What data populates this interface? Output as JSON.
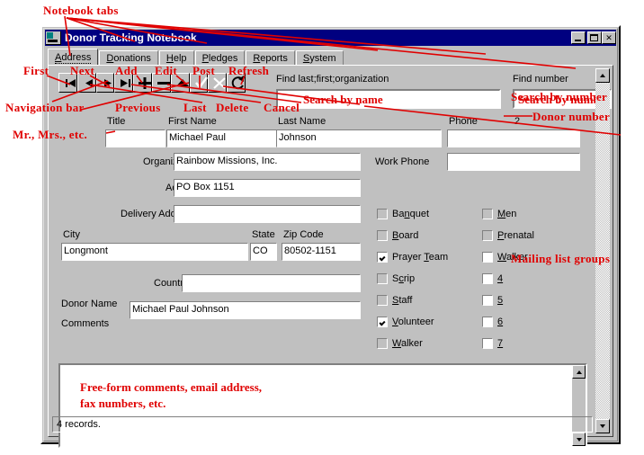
{
  "window": {
    "title": "Donor Tracking Notebook",
    "minimize_label": "Minimize",
    "maximize_label": "Maximize",
    "close_label": "✕"
  },
  "tabs": [
    {
      "label": "Address",
      "active": true
    },
    {
      "label": "Donations",
      "active": false
    },
    {
      "label": "Help",
      "active": false
    },
    {
      "label": "Pledges",
      "active": false
    },
    {
      "label": "Reports",
      "active": false
    },
    {
      "label": "System",
      "active": false
    }
  ],
  "navbar": {
    "buttons": [
      {
        "name": "first",
        "glyph": "first"
      },
      {
        "name": "previous",
        "glyph": "prev"
      },
      {
        "name": "next",
        "glyph": "next"
      },
      {
        "name": "last",
        "glyph": "last"
      },
      {
        "name": "add",
        "glyph": "plus"
      },
      {
        "name": "delete",
        "glyph": "minus"
      },
      {
        "name": "edit",
        "glyph": "triangle"
      },
      {
        "name": "post",
        "glyph": "check"
      },
      {
        "name": "cancel",
        "glyph": "xmark"
      },
      {
        "name": "refresh",
        "glyph": "refresh"
      }
    ]
  },
  "find": {
    "name_label": "Find last;first;organization",
    "name_value": "Search by name",
    "number_label": "Find number",
    "number_value": "Search by number"
  },
  "form": {
    "title_label": "Title",
    "title_value": "",
    "first_name_label": "First Name",
    "first_name_value": "Michael Paul",
    "last_name_label": "Last Name",
    "last_name_value": "Johnson",
    "phone_label": "Phone",
    "phone_value": "",
    "donor_number": "2",
    "organization_label": "Organization",
    "organization_value": "Rainbow Missions, Inc.",
    "work_phone_label": "Work Phone",
    "work_phone_value": "",
    "address_label": "Address",
    "address_value": "PO Box 1151",
    "delivery_address_label": "Delivery Address",
    "delivery_address_value": "",
    "city_label": "City",
    "city_value": "Longmont",
    "state_label": "State",
    "state_value": "CO",
    "zip_label": "Zip Code",
    "zip_value": "80502-1151",
    "country_label": "Country",
    "country_value": "",
    "donor_name_label": "Donor Name",
    "donor_name_value": "Michael Paul Johnson",
    "comments_label": "Comments",
    "comments_value": ""
  },
  "groups": {
    "left": [
      {
        "label": "Banquet",
        "accel": "q",
        "checked": false,
        "dim": true
      },
      {
        "label": "Board",
        "accel": "B",
        "checked": false,
        "dim": true
      },
      {
        "label": "Prayer Team",
        "accel": "T",
        "checked": true,
        "dim": false
      },
      {
        "label": "Scrip",
        "accel": "c",
        "checked": false,
        "dim": true
      },
      {
        "label": "Staff",
        "accel": "S",
        "checked": false,
        "dim": true
      },
      {
        "label": "Volunteer",
        "accel": "V",
        "checked": true,
        "dim": false
      },
      {
        "label": "Walker",
        "accel": "W",
        "checked": false,
        "dim": true
      }
    ],
    "right": [
      {
        "label": "Men",
        "accel": "M",
        "checked": false,
        "dim": true
      },
      {
        "label": "Prenatal",
        "accel": "P",
        "checked": false,
        "dim": true
      },
      {
        "label": "Walker",
        "accel": "W",
        "checked": false,
        "dim": false
      },
      {
        "label": "4",
        "accel": "4",
        "checked": false,
        "dim": false
      },
      {
        "label": "5",
        "accel": "5",
        "checked": false,
        "dim": false
      },
      {
        "label": "6",
        "accel": "6",
        "checked": false,
        "dim": false
      },
      {
        "label": "7",
        "accel": "7",
        "checked": false,
        "dim": false
      }
    ]
  },
  "status": {
    "text": "4 records."
  },
  "annotations": {
    "notebook_tabs": "Notebook tabs",
    "first": "First",
    "next": "Next",
    "add": "Add",
    "edit": "Edit",
    "post": "Post",
    "refresh": "Refresh",
    "navigation_bar": "Navigation bar",
    "previous": "Previous",
    "last": "Last",
    "delete": "Delete",
    "cancel": "Cancel",
    "mr_mrs": "Mr., Mrs., etc.",
    "search_by_name": "Search by name",
    "search_by_number": "Search by number",
    "donor_number": "Donor number",
    "mailing_list_groups": "Mailing list groups",
    "free_form_line1": "Free-form comments, email address,",
    "free_form_line2": "fax numbers, etc."
  },
  "colors": {
    "annotation": "#e00000",
    "titlebar": "#000080",
    "face": "#c0c0c0",
    "field": "#ffffff"
  }
}
